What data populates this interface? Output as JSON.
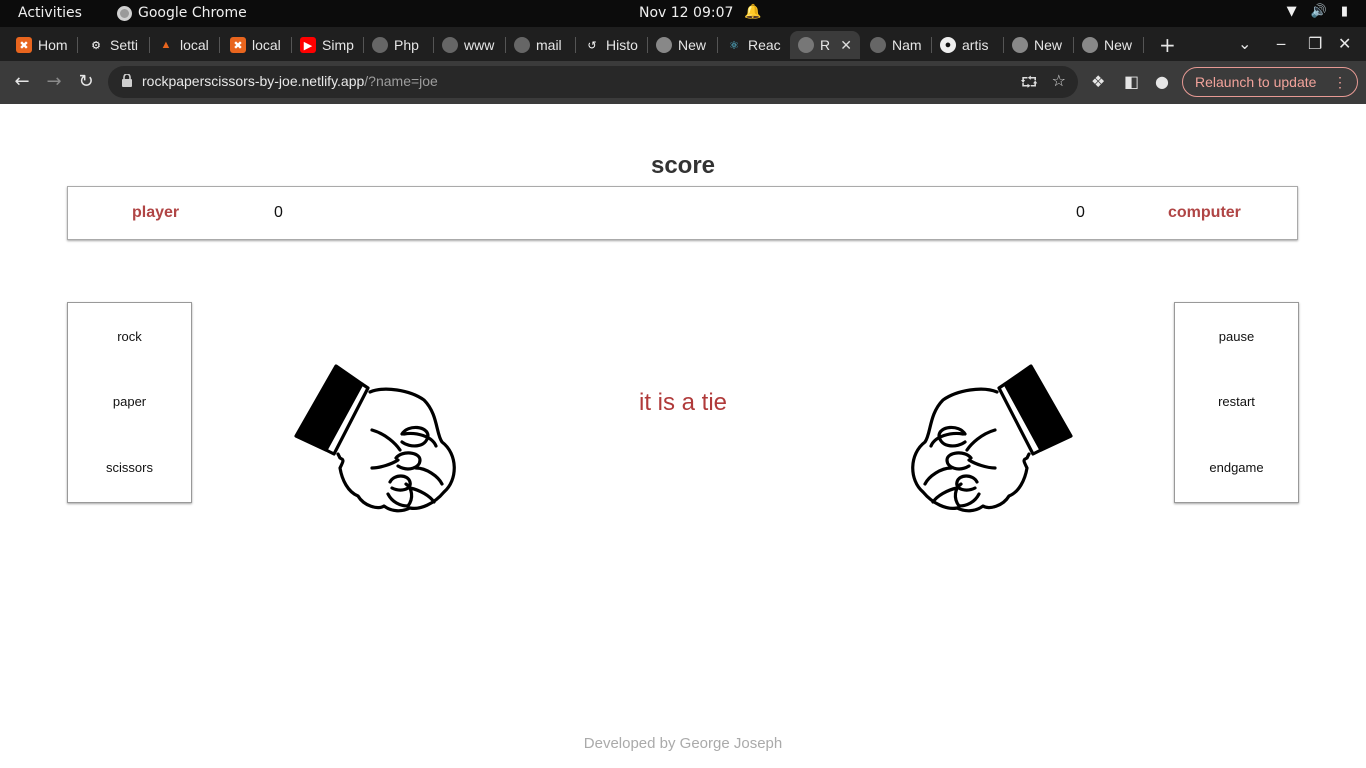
{
  "system": {
    "activities": "Activities",
    "app_name": "Google Chrome",
    "clock": "Nov 12  09:07"
  },
  "tabs": [
    {
      "label": "Hom",
      "icon": "xampp-icon",
      "color": "#e8651e"
    },
    {
      "label": "Setti",
      "icon": "gear-icon",
      "color": "#1f1f1f"
    },
    {
      "label": "local",
      "icon": "cpanel-icon",
      "color": "#e8651e"
    },
    {
      "label": "local",
      "icon": "xampp-icon",
      "color": "#e8651e"
    },
    {
      "label": "Simp",
      "icon": "youtube-icon",
      "color": "#ff0000"
    },
    {
      "label": "Php",
      "icon": "globe-icon",
      "color": "#555"
    },
    {
      "label": "www",
      "icon": "globe-icon",
      "color": "#555"
    },
    {
      "label": "mail",
      "icon": "globe-icon",
      "color": "#555"
    },
    {
      "label": "Histo",
      "icon": "history-icon",
      "color": "#555"
    },
    {
      "label": "New",
      "icon": "chrome-icon",
      "color": "#555"
    },
    {
      "label": "Reac",
      "icon": "react-icon",
      "color": "#61dafb"
    },
    {
      "label": "R",
      "icon": "globe-icon",
      "color": "#555",
      "active": true
    },
    {
      "label": "Nam",
      "icon": "globe-icon",
      "color": "#555"
    },
    {
      "label": "artis",
      "icon": "github-icon",
      "color": "#555"
    },
    {
      "label": "New",
      "icon": "chrome-icon",
      "color": "#555"
    },
    {
      "label": "New",
      "icon": "chrome-icon",
      "color": "#555"
    }
  ],
  "toolbar": {
    "url_host": "rockpaperscissors-by-joe.netlify.app",
    "url_query": "/?name=joe",
    "relaunch_label": "Relaunch to update"
  },
  "game": {
    "score_title": "score",
    "player_label": "player",
    "player_score": "0",
    "computer_score": "0",
    "computer_label": "computer",
    "choices": [
      "rock",
      "paper",
      "scissors"
    ],
    "controls": [
      "pause",
      "restart",
      "endgame"
    ],
    "result_text": "it is a tie",
    "player_hand": "rock",
    "computer_hand": "rock"
  },
  "footer": "Developed by George Joseph",
  "colors": {
    "accent_red": "#b04545",
    "result_red": "#b03a3a",
    "footer_gray": "#aaaaaa"
  }
}
